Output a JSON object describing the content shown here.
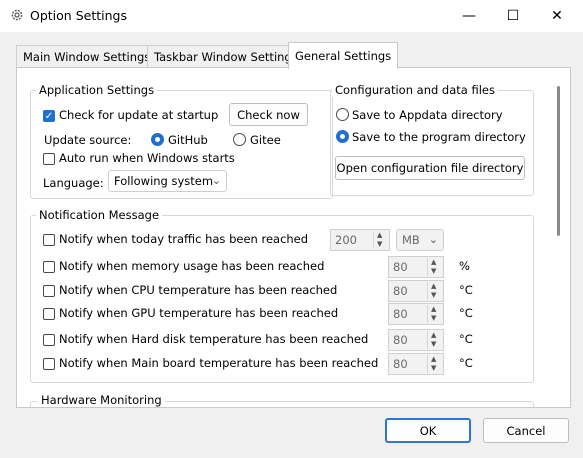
{
  "window": {
    "title": "Option Settings",
    "minimize": "—",
    "maximize": "☐",
    "close": "✕"
  },
  "tabs": [
    {
      "label": "Main Window Settings"
    },
    {
      "label": "Taskbar Window Settings"
    },
    {
      "label": "General Settings"
    }
  ],
  "app_settings": {
    "legend": "Application Settings",
    "check_update_label": "Check for update at startup",
    "check_now_label": "Check now",
    "update_source_label": "Update source:",
    "source_github": "GitHub",
    "source_gitee": "Gitee",
    "auto_run_label": "Auto run when Windows starts",
    "language_label": "Language:",
    "language_value": "Following system"
  },
  "config_files": {
    "legend": "Configuration and data files",
    "save_appdata": "Save to Appdata directory",
    "save_program": "Save to the program directory",
    "open_dir_label": "Open configuration file directory"
  },
  "notification": {
    "legend": "Notification Message",
    "rows": [
      {
        "label": "Notify when today traffic has been reached",
        "value": "200",
        "unit": "MB"
      },
      {
        "label": "Notify when memory usage has been reached",
        "value": "80",
        "unit": "%"
      },
      {
        "label": "Notify when CPU temperature has been reached",
        "value": "80",
        "unit": "°C"
      },
      {
        "label": "Notify when GPU temperature has been reached",
        "value": "80",
        "unit": "°C"
      },
      {
        "label": "Notify when Hard disk temperature has been reached",
        "value": "80",
        "unit": "°C"
      },
      {
        "label": "Notify when Main board temperature has been reached",
        "value": "80",
        "unit": "°C"
      }
    ]
  },
  "hardware": {
    "legend": "Hardware Monitoring"
  },
  "footer": {
    "ok_label": "OK",
    "cancel_label": "Cancel"
  }
}
